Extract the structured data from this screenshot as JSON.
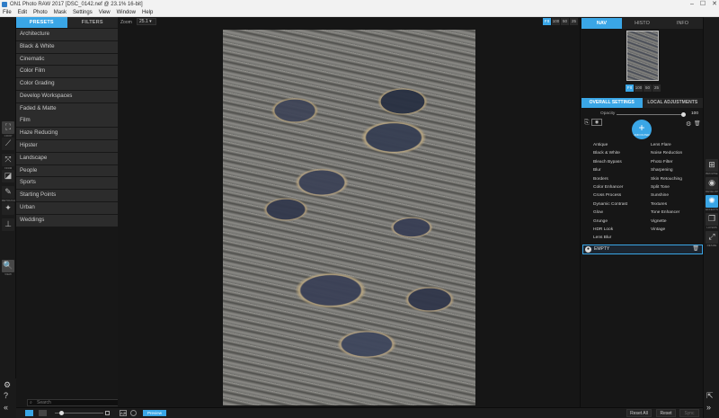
{
  "window": {
    "title": "ON1 Photo RAW 2017 [DSC_0142.nef @ 23.1% 16-bit]",
    "min": "–",
    "max": "☐",
    "close": "✕"
  },
  "menu": [
    "File",
    "Edit",
    "Photo",
    "Mask",
    "Settings",
    "View",
    "Window",
    "Help"
  ],
  "left_tools": [
    {
      "icon": "crop-icon",
      "glyph": "⛶",
      "label": "CROP"
    },
    {
      "icon": "brush-icon",
      "glyph": "⟋",
      "label": ""
    },
    {
      "icon": "transform-icon",
      "glyph": "⤧",
      "label": "XFRM"
    },
    {
      "icon": "eraser-icon",
      "glyph": "◪",
      "label": ""
    },
    {
      "icon": "retouch-icon",
      "glyph": "✎",
      "label": "RETOUCH"
    },
    {
      "icon": "clone-icon",
      "glyph": "✦",
      "label": ""
    },
    {
      "icon": "stamp-icon",
      "glyph": "⊥",
      "label": ""
    },
    {
      "icon": "zoom-icon",
      "glyph": "🔍",
      "label": "VIEW"
    }
  ],
  "presets": {
    "tabs": [
      "PRESETS",
      "FILTERS"
    ],
    "items": [
      "Architecture",
      "Black & White",
      "Cinematic",
      "Color Film",
      "Color Grading",
      "Develop Workspaces",
      "Faded & Matte",
      "Film",
      "Haze Reducing",
      "Hipster",
      "Landscape",
      "People",
      "Sports",
      "Starting Points",
      "Urban",
      "Weddings"
    ],
    "search_placeholder": "Search"
  },
  "canvas": {
    "zoom_label": "Zoom",
    "zoom_value": "25.1 ▾",
    "zoom_buttons": [
      "FIt",
      "100",
      "50",
      "25"
    ]
  },
  "right": {
    "nav_tabs": [
      "NAV",
      "HISTO",
      "INFO"
    ],
    "nav_zoom": [
      "FIt",
      "100",
      "50",
      "25"
    ],
    "adj_tabs": [
      "OVERALL SETTINGS",
      "LOCAL ADJUSTMENTS"
    ],
    "opacity_label": "Opacity",
    "opacity_value": "100",
    "opacity_fraction": 1.0,
    "add_filter_sub": "ADD FILTER",
    "filters_left": [
      "Antique",
      "Black & White",
      "Bleach Bypass",
      "Blur",
      "Borders",
      "Color Enhancer",
      "Cross Process",
      "Dynamic Contrast",
      "Glow",
      "Grunge",
      "HDR Look",
      "Lens Blur"
    ],
    "filters_right": [
      "Lens Flare",
      "Noise Reduction",
      "Photo Filter",
      "Sharpening",
      "Skin Retouching",
      "Split Tone",
      "Sunshine",
      "Textures",
      "Tone Enhancer",
      "Vignette",
      "Vintage"
    ],
    "empty_label": "EMPTY"
  },
  "right_tools": [
    {
      "icon": "browse-icon",
      "glyph": "⊞",
      "label": "BROWSE"
    },
    {
      "icon": "develop-icon",
      "glyph": "◉",
      "label": "DEVELOP"
    },
    {
      "icon": "effects-icon",
      "glyph": "✺",
      "label": "EFFECTS"
    },
    {
      "icon": "layers-icon",
      "glyph": "❐",
      "label": "LAYERS"
    },
    {
      "icon": "resize-icon",
      "glyph": "⤢",
      "label": "RESIZE"
    }
  ],
  "bottom": {
    "compare_label": "A|B",
    "preview_label": "Preview",
    "reset_all_label": "Reset All",
    "reset_label": "Reset",
    "sync_label": "Sync"
  },
  "colors": {
    "accent": "#3aa6e6",
    "panel": "#171717",
    "item": "#2c2c2c"
  }
}
